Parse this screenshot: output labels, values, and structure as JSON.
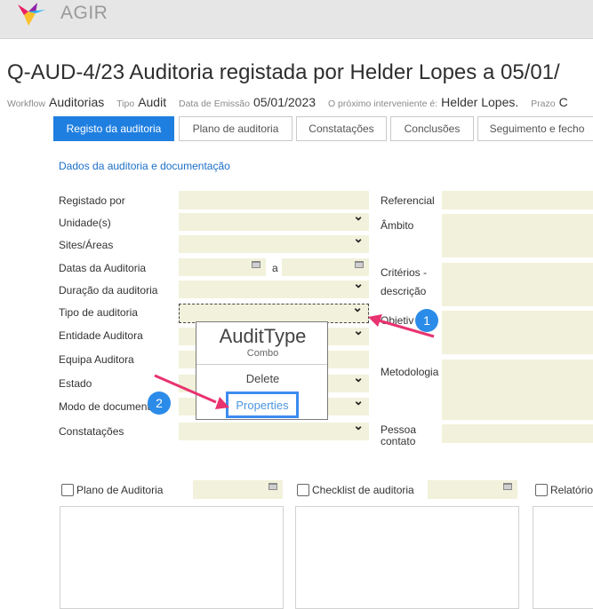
{
  "app": {
    "name": "AGIR"
  },
  "title": "Q-AUD-4/23 Auditoria registada por Helder Lopes a 05/01/",
  "meta": {
    "workflow_label": "Workflow",
    "workflow_value": "Auditorias",
    "tipo_label": "Tipo",
    "tipo_value": "Audit",
    "data_label": "Data de Emissão",
    "data_value": "05/01/2023",
    "proximo_label": "O próximo interveniente é:",
    "proximo_value": "Helder Lopes.",
    "prazo_label": "Prazo",
    "prazo_value": "C"
  },
  "tabs": [
    "Registo da auditoria",
    "Plano de auditoria",
    "Constatações",
    "Conclusões",
    "Seguimento e fecho"
  ],
  "section_title": "Dados da auditoria e documentação",
  "left_fields": {
    "registado": "Registado por",
    "unidades": "Unidade(s)",
    "sites": "Sites/Áreas",
    "datas": "Datas da Auditoria",
    "datas_sep": "a",
    "duracao": "Duração da auditoria",
    "tipo": "Tipo de auditoria",
    "entidade": "Entidade Auditora",
    "equipa": "Equipa Auditora",
    "estado": "Estado",
    "modo": "Modo de document",
    "constatacoes": "Constatações"
  },
  "right_fields": {
    "referencial": "Referencial",
    "ambito": "Âmbito",
    "criterios_1": "Critérios -",
    "criterios_2": "descrição",
    "objetivo": "Objetiv",
    "metodologia": "Metodologia",
    "pessoa_1": "Pessoa",
    "pessoa_2": "contato"
  },
  "popup": {
    "title": "AuditType",
    "subtitle": "Combo",
    "delete": "Delete",
    "properties": "Properties"
  },
  "badges": {
    "one": "1",
    "two": "2"
  },
  "bottom": {
    "plano": "Plano de Auditoria",
    "checklist": "Checklist de auditoria",
    "relatorio": "Relatório"
  },
  "colors": {
    "accent": "#1f7fe0",
    "field_bg": "#f2f1db",
    "link": "#1c6fc7",
    "arrow": "#e8336f"
  }
}
